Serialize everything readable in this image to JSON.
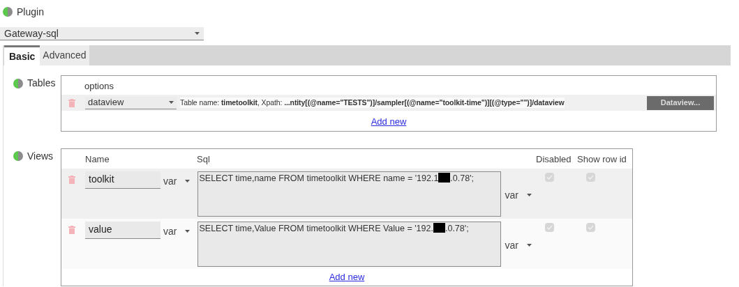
{
  "plugin": {
    "label": "Plugin",
    "value": "Gateway-sql"
  },
  "tabs": [
    {
      "label": "Basic",
      "selected": true
    },
    {
      "label": "Advanced",
      "selected": false
    }
  ],
  "tables": {
    "label": "Tables",
    "column": "options",
    "rows": [
      {
        "type": "dataview",
        "description": "Table name: **timetoolkit**, Xpath: **...ntity[(@name=\"TESTS\")]/sampler[(@name=\"toolkit-time\")][(@type=\"\")]/dataview**",
        "button": "Dataview..."
      }
    ],
    "add_new": "Add new"
  },
  "views": {
    "label": "Views",
    "columns": [
      "Name",
      "Sql",
      "Disabled",
      "Show row id"
    ],
    "rows": [
      {
        "name": "toolkit",
        "name_type": "var",
        "sql_before": "SELECT time,name FROM timetoolkit WHERE name = '192.1",
        "sql_after": ".0.78';",
        "sql_type": "var",
        "disabled": true,
        "show_row_id": true
      },
      {
        "name": "value",
        "name_type": "var",
        "sql_before": "SELECT time,Value FROM timetoolkit WHERE Value = '192.",
        "sql_after": ".0.78';",
        "sql_type": "var",
        "disabled": true,
        "show_row_id": true
      }
    ],
    "add_new": "Add new"
  }
}
